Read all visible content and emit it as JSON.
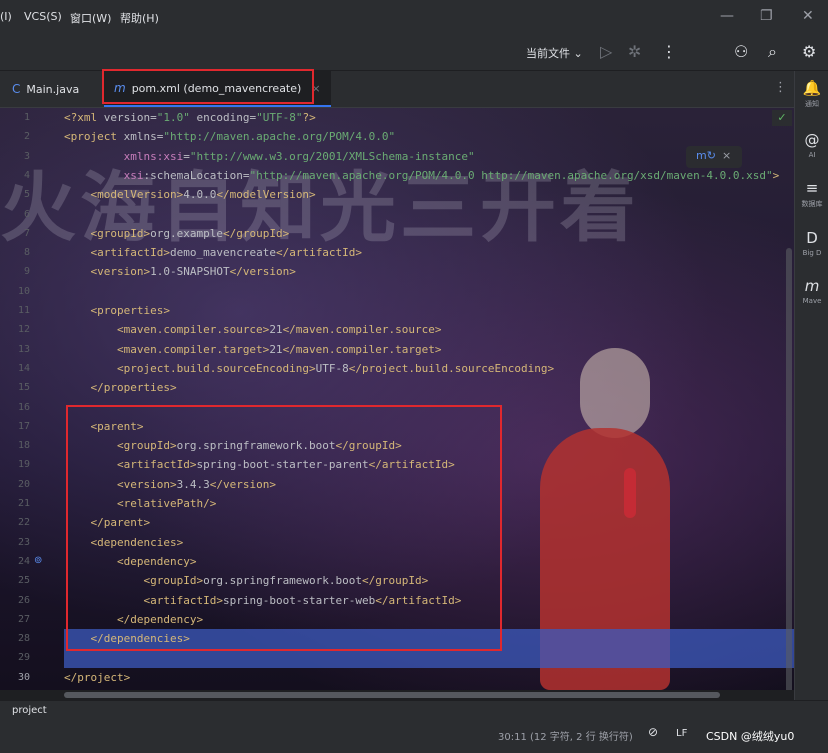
{
  "menu": [
    "(I)",
    "VCS(S)",
    "窗口(W)",
    "帮助(H)"
  ],
  "window_controls": {
    "minimize": "—",
    "maximize": "❐",
    "close": "✕"
  },
  "toolbar": {
    "run_config": "当前文件 ⌄",
    "run_icon": "▷",
    "debug_icon": "✲",
    "more_icon": "⋮",
    "user_icon": "⚇",
    "search_icon": "⌕",
    "settings_icon": "⚙"
  },
  "tabs": [
    {
      "label": "Main.java",
      "icon": "C",
      "active": false
    },
    {
      "label": "pom.xml (demo_mavencreate)",
      "icon": "m",
      "active": true,
      "close": "×"
    }
  ],
  "tab_more": "⋮",
  "right_panel": [
    {
      "icon": "🔔",
      "label": "通知"
    },
    {
      "icon": "@",
      "label": "AI"
    },
    {
      "icon": "≡",
      "label": "数据库"
    },
    {
      "icon": "D",
      "label": "Big D"
    },
    {
      "icon": "m",
      "label": "Mave"
    }
  ],
  "watermark_text": "火海自知光三开着",
  "code_lines": [
    {
      "n": "1",
      "html": "<span class='tg'>&lt;?xml</span> <span class='at'>version=</span><span class='st'>\"1.0\"</span> <span class='at'>encoding=</span><span class='st'>\"UTF-8\"</span><span class='tg'>?&gt;</span>"
    },
    {
      "n": "2",
      "html": "<span class='tg'>&lt;project</span> <span class='at'>xmlns=</span><span class='st'>\"http://maven.apache.org/POM/4.0.0\"</span>"
    },
    {
      "n": "3",
      "html": "         <span class='ns'>xmlns:xsi</span><span class='at'>=</span><span class='st'>\"http://www.w3.org/2001/XMLSchema-instance\"</span>"
    },
    {
      "n": "4",
      "html": "         <span class='ns'>xsi</span><span class='at'>:schemaLocation=</span><span class='st'>\"http://maven.apache.org/POM/4.0.0 http://maven.apache.org/xsd/maven-4.0.0.xsd\"</span><span class='tg'>&gt;</span>"
    },
    {
      "n": "5",
      "html": "    <span class='tg'>&lt;modelVersion&gt;</span>4.0.0<span class='tg'>&lt;/modelVersion&gt;</span>"
    },
    {
      "n": "6",
      "html": ""
    },
    {
      "n": "7",
      "html": "    <span class='tg'>&lt;groupId&gt;</span>org.example<span class='tg'>&lt;/groupId&gt;</span>"
    },
    {
      "n": "8",
      "html": "    <span class='tg'>&lt;artifactId&gt;</span>demo_mavencreate<span class='tg'>&lt;/artifactId&gt;</span>"
    },
    {
      "n": "9",
      "html": "    <span class='tg'>&lt;version&gt;</span>1.0-SNAPSHOT<span class='tg'>&lt;/version&gt;</span>"
    },
    {
      "n": "10",
      "html": ""
    },
    {
      "n": "11",
      "html": "    <span class='tg'>&lt;properties&gt;</span>"
    },
    {
      "n": "12",
      "html": "        <span class='tg'>&lt;maven.compiler.source&gt;</span>21<span class='tg'>&lt;/maven.compiler.source&gt;</span>"
    },
    {
      "n": "13",
      "html": "        <span class='tg'>&lt;maven.compiler.target&gt;</span>21<span class='tg'>&lt;/maven.compiler.target&gt;</span>"
    },
    {
      "n": "14",
      "html": "        <span class='tg'>&lt;project.build.sourceEncoding&gt;</span>UTF-8<span class='tg'>&lt;/project.build.sourceEncoding&gt;</span>"
    },
    {
      "n": "15",
      "html": "    <span class='tg'>&lt;/properties&gt;</span>"
    },
    {
      "n": "16",
      "html": ""
    },
    {
      "n": "17",
      "html": "    <span class='tg'>&lt;parent&gt;</span>"
    },
    {
      "n": "18",
      "html": "        <span class='tg'>&lt;groupId&gt;</span>org.springframework.boot<span class='tg'>&lt;/groupId&gt;</span>"
    },
    {
      "n": "19",
      "html": "        <span class='tg'>&lt;artifactId&gt;</span>spring-boot-starter-parent<span class='tg'>&lt;/artifactId&gt;</span>"
    },
    {
      "n": "20",
      "html": "        <span class='tg'>&lt;version&gt;</span>3.4.3<span class='tg'>&lt;/version&gt;</span>"
    },
    {
      "n": "21",
      "html": "        <span class='tg'>&lt;relativePath/&gt;</span>"
    },
    {
      "n": "22",
      "html": "    <span class='tg'>&lt;/parent&gt;</span>"
    },
    {
      "n": "23",
      "html": "    <span class='tg'>&lt;dependencies&gt;</span>"
    },
    {
      "n": "24",
      "html": "        <span class='tg'>&lt;dependency&gt;</span>"
    },
    {
      "n": "25",
      "html": "            <span class='tg'>&lt;groupId&gt;</span>org.springframework.boot<span class='tg'>&lt;/groupId&gt;</span>"
    },
    {
      "n": "26",
      "html": "            <span class='tg'>&lt;artifactId&gt;</span>spring-boot-starter-web<span class='tg'>&lt;/artifactId&gt;</span>"
    },
    {
      "n": "27",
      "html": "        <span class='tg'>&lt;/dependency&gt;</span>"
    },
    {
      "n": "28",
      "html": "    <span class='tg'>&lt;/dependencies&gt;</span>"
    },
    {
      "n": "29",
      "html": ""
    },
    {
      "n": "30",
      "html": "<span class='tg'>&lt;/project&gt;</span>"
    }
  ],
  "current_line": "30",
  "highlighted_lines": [
    "28",
    "29"
  ],
  "gutter_marker_line": "24",
  "gutter_marker_icon": "⊚",
  "ok_badge": "✓",
  "popup": {
    "icon": "m↻",
    "close": "×"
  },
  "status": {
    "breadcrumb": "project",
    "position": "30:11 (12 字符, 2 行 换行符)",
    "encoding_icon": "⊘",
    "line_ending": "LF",
    "csdn": "CSDN @绒绒yu0"
  }
}
